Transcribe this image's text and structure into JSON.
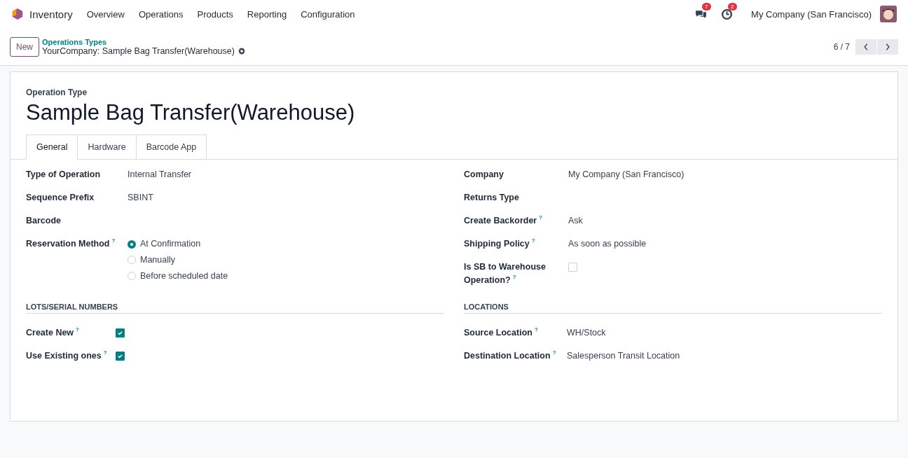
{
  "navbar": {
    "app_name": "Inventory",
    "menu": [
      "Overview",
      "Operations",
      "Products",
      "Reporting",
      "Configuration"
    ],
    "messages_badge": "7",
    "activities_badge": "2",
    "company": "My Company (San Francisco)"
  },
  "control_panel": {
    "new_button": "New",
    "breadcrumb_parent": "Operations Types",
    "breadcrumb_current": "YourCompany: Sample Bag Transfer(Warehouse)",
    "pager": "6 / 7"
  },
  "form": {
    "caption": "Operation Type",
    "title": "Sample Bag Transfer(Warehouse)",
    "tabs": [
      {
        "label": "General",
        "selected": true
      },
      {
        "label": "Hardware",
        "selected": false
      },
      {
        "label": "Barcode App",
        "selected": false
      }
    ],
    "left_fields": [
      {
        "label": "Type of Operation",
        "kind": "text",
        "value": "Internal Transfer"
      },
      {
        "label": "Sequence Prefix",
        "kind": "text",
        "value": "SBINT"
      },
      {
        "label": "Barcode",
        "kind": "empty"
      },
      {
        "label": "Reservation Method",
        "help": "?",
        "kind": "radio",
        "options": [
          {
            "label": "At Confirmation",
            "selected": true
          },
          {
            "label": "Manually",
            "selected": false
          },
          {
            "label": "Before scheduled date",
            "selected": false
          }
        ]
      }
    ],
    "right_fields": [
      {
        "label": "Company",
        "kind": "text",
        "value": "My Company (San Francisco)"
      },
      {
        "label": "Returns Type",
        "kind": "empty"
      },
      {
        "label": "Create Backorder",
        "help": "?",
        "kind": "text",
        "value": "Ask"
      },
      {
        "label": "Shipping Policy",
        "help": "?",
        "kind": "text",
        "value": "As soon as possible"
      },
      {
        "label": "Is SB to Warehouse Operation?",
        "help": "?",
        "kind": "checkbox",
        "checked": false
      }
    ],
    "sections": [
      {
        "title": "LOTS/SERIAL NUMBERS",
        "fields": [
          {
            "label": "Create New",
            "help": "?",
            "kind": "checkbox",
            "checked": true
          },
          {
            "label": "Use Existing ones",
            "help": "?",
            "kind": "checkbox",
            "checked": true
          }
        ]
      },
      {
        "title": "LOCATIONS",
        "fields": [
          {
            "label": "Source Location",
            "help": "?",
            "kind": "text",
            "value": "WH/Stock"
          },
          {
            "label": "Destination Location",
            "help": "?",
            "kind": "text",
            "value": "Salesperson Transit Location"
          }
        ]
      }
    ]
  }
}
